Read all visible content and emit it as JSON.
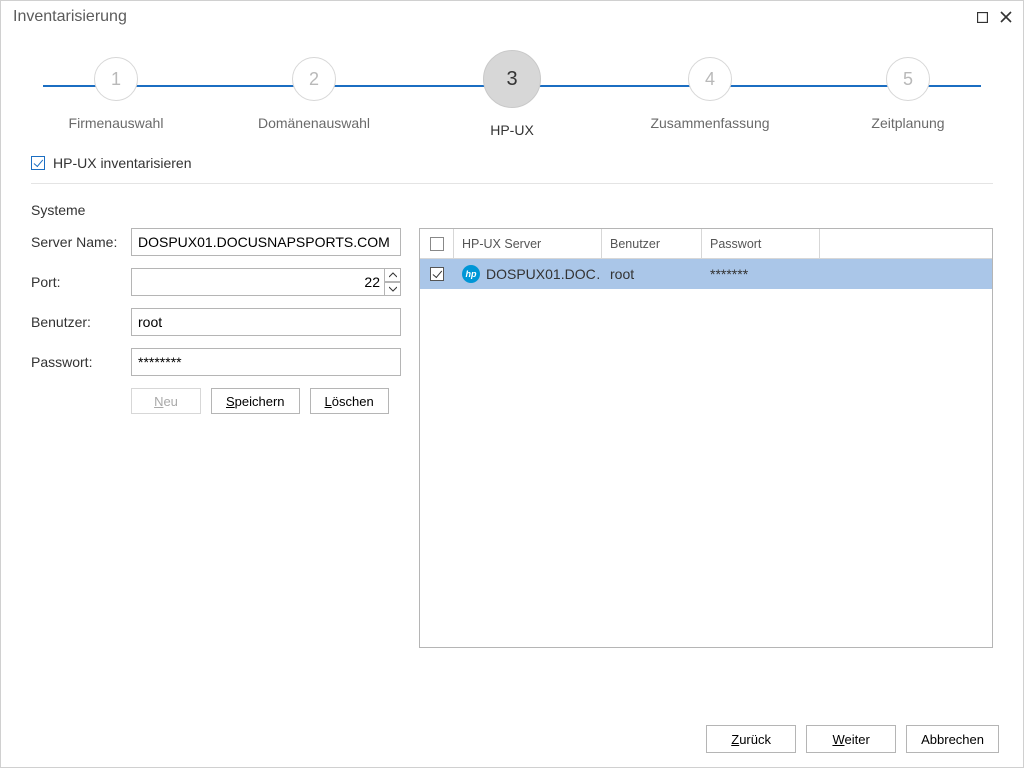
{
  "title": "Inventarisierung",
  "stepper": {
    "steps": [
      {
        "num": "1",
        "label": "Firmenauswahl"
      },
      {
        "num": "2",
        "label": "Domänenauswahl"
      },
      {
        "num": "3",
        "label": "HP-UX"
      },
      {
        "num": "4",
        "label": "Zusammenfassung"
      },
      {
        "num": "5",
        "label": "Zeitplanung"
      }
    ],
    "active_index": 2
  },
  "inventory_checkbox": {
    "label": "HP-UX  inventarisieren",
    "checked": true
  },
  "section_title": "Systeme",
  "form": {
    "server_label": "Server Name:",
    "server_value": "DOSPUX01.DOCUSNAPSPORTS.COM",
    "port_label": "Port:",
    "port_value": "22",
    "user_label": "Benutzer:",
    "user_value": "root",
    "password_label": "Passwort:",
    "password_value": "********",
    "buttons": {
      "new_prefix": "N",
      "new_rest": "eu",
      "save_prefix": "S",
      "save_rest": "peichern",
      "delete_prefix": "L",
      "delete_rest": "öschen"
    }
  },
  "table": {
    "headers": {
      "server": "HP-UX Server",
      "user": "Benutzer",
      "password": "Passwort"
    },
    "rows": [
      {
        "checked": true,
        "server": "DOSPUX01.DOC…",
        "user": "root",
        "password": "*******"
      }
    ]
  },
  "footer": {
    "back_prefix": "Z",
    "back_rest": "urück",
    "next_prefix": "W",
    "next_rest": "eiter",
    "cancel": "Abbrechen"
  },
  "hp_glyph": "hp"
}
